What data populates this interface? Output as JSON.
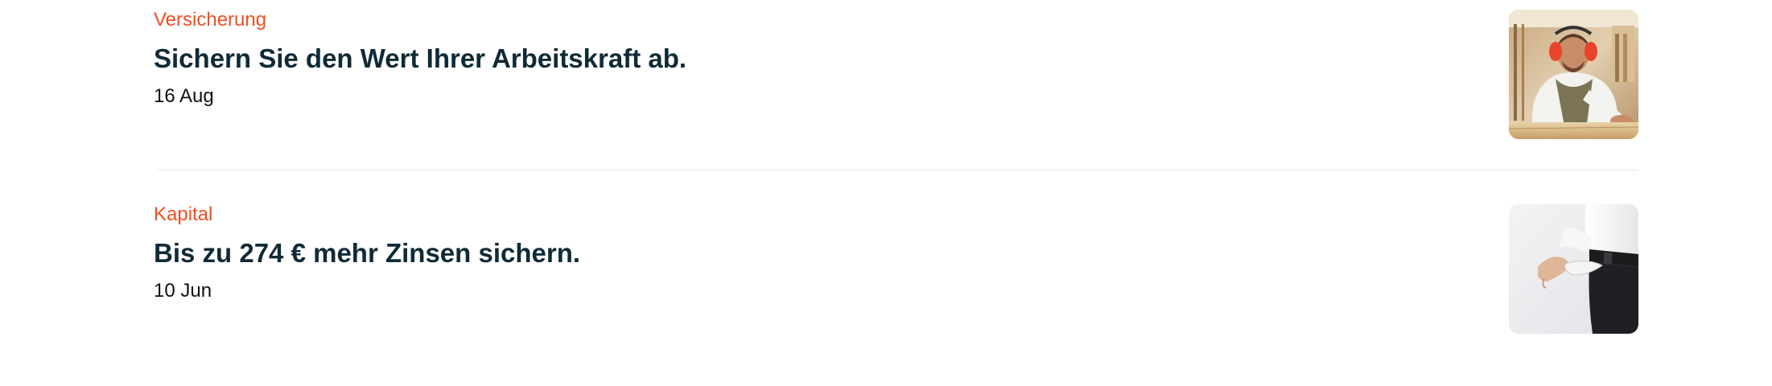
{
  "articles": [
    {
      "category": "Versicherung",
      "title": "Sichern Sie den Wert Ihrer Arbeitskraft ab.",
      "date": "16 Aug",
      "image": "carpenter-photo"
    },
    {
      "category": "Kapital",
      "title": "Bis zu 274 € mehr Zinsen sichern.",
      "date": "10 Jun",
      "image": "empty-pocket-photo"
    }
  ],
  "colors": {
    "category": "#f04e23",
    "title": "#102a37",
    "divider": "#e3e3e3"
  }
}
